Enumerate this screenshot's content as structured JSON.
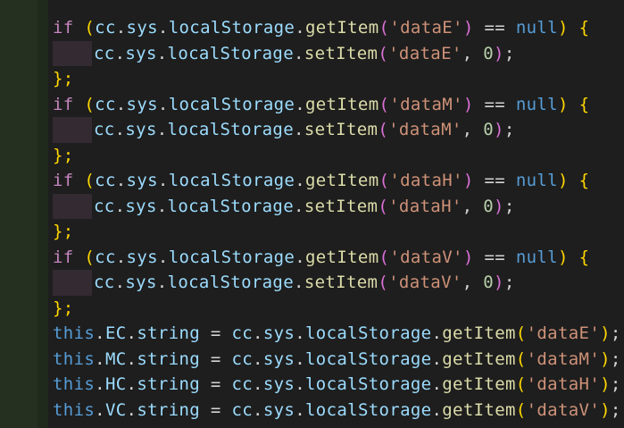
{
  "code": {
    "if_kw": "if",
    "null_kw": "null",
    "this_kw": "this",
    "cc": "cc",
    "sys": "sys",
    "localStorage": "localStorage",
    "getItem": "getItem",
    "setItem": "setItem",
    "string": "string",
    "eq_op": "==",
    "assign_op": "=",
    "zero": "0",
    "open_brace": "{",
    "close_brace": "};",
    "blocks": [
      {
        "key": "'dataE'",
        "field": "EC"
      },
      {
        "key": "'dataM'",
        "field": "MC"
      },
      {
        "key": "'dataH'",
        "field": "HC"
      },
      {
        "key": "'dataV'",
        "field": "VC"
      }
    ]
  },
  "colors": {
    "background": "#1e1e1e",
    "keyword": "#569cd6",
    "control": "#c586c0",
    "function": "#dcdcaa",
    "string": "#ce9178",
    "variable": "#9cdcfe",
    "bracket_gold": "#ffd700",
    "bracket_pink": "#da70d6",
    "number": "#b5cea8"
  }
}
